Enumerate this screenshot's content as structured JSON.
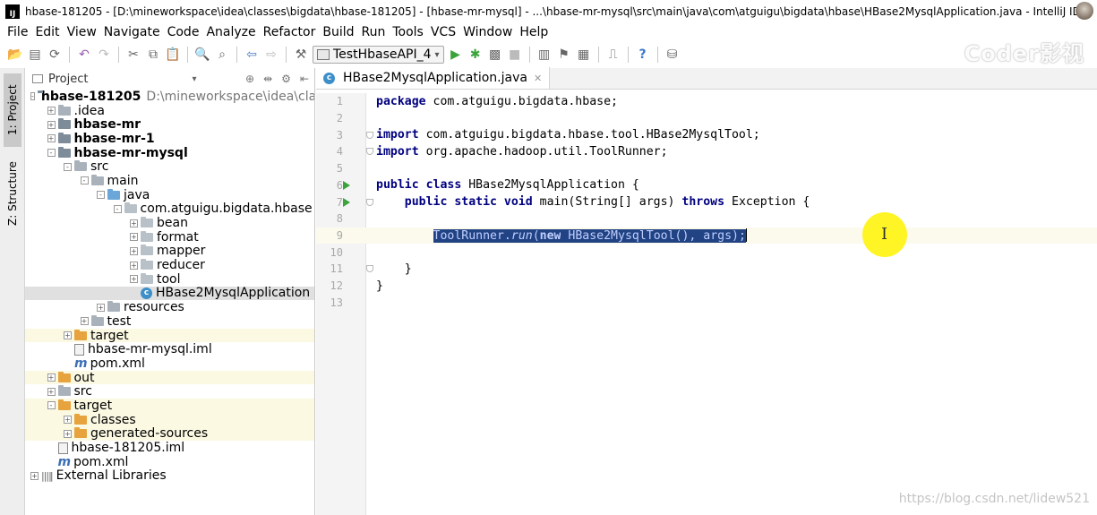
{
  "window": {
    "logo_text": "IJ",
    "title": "hbase-181205 - [D:\\mineworkspace\\idea\\classes\\bigdata\\hbase-181205] - [hbase-mr-mysql] - ...\\hbase-mr-mysql\\src\\main\\java\\com\\atguigu\\bigdata\\hbase\\HBase2MysqlApplication.java - IntelliJ IDEA 20..."
  },
  "menu": [
    "File",
    "Edit",
    "View",
    "Navigate",
    "Code",
    "Analyze",
    "Refactor",
    "Build",
    "Run",
    "Tools",
    "VCS",
    "Window",
    "Help"
  ],
  "toolbar": {
    "run_config": "TestHbaseAPI_4",
    "icons": [
      "open-icon",
      "save-icon",
      "sync-icon",
      "undo-icon",
      "redo-icon",
      "cut-icon",
      "copy-icon",
      "paste-icon",
      "find-icon",
      "replace-icon",
      "back-icon",
      "forward-icon",
      "build-icon",
      "run-icon",
      "debug-icon",
      "coverage-icon",
      "stop-icon",
      "project-structure-icon",
      "sdk-icon",
      "help-icon",
      "vcs-icon"
    ],
    "watermark": "Coder影视"
  },
  "left_strip": {
    "project_label": "1: Project",
    "structure_label": "Z: Structure"
  },
  "project_panel": {
    "header": "Project",
    "tree": [
      {
        "label": "hbase-181205",
        "extra": "D:\\mineworkspace\\idea\\cla",
        "depth": 0,
        "icon": "module",
        "bold": true,
        "exp": "-"
      },
      {
        "label": ".idea",
        "depth": 1,
        "icon": "gray",
        "exp": "+"
      },
      {
        "label": "hbase-mr",
        "depth": 1,
        "icon": "module",
        "bold": true,
        "exp": "+"
      },
      {
        "label": "hbase-mr-1",
        "depth": 1,
        "icon": "module",
        "bold": true,
        "exp": "+"
      },
      {
        "label": "hbase-mr-mysql",
        "depth": 1,
        "icon": "module",
        "bold": true,
        "exp": "-"
      },
      {
        "label": "src",
        "depth": 2,
        "icon": "gray",
        "exp": "-"
      },
      {
        "label": "main",
        "depth": 3,
        "icon": "gray",
        "exp": "-"
      },
      {
        "label": "java",
        "depth": 4,
        "icon": "blue",
        "exp": "-"
      },
      {
        "label": "com.atguigu.bigdata.hbase",
        "depth": 5,
        "icon": "pkg",
        "exp": "-"
      },
      {
        "label": "bean",
        "depth": 6,
        "icon": "pkg",
        "exp": "+"
      },
      {
        "label": "format",
        "depth": 6,
        "icon": "pkg",
        "exp": "+"
      },
      {
        "label": "mapper",
        "depth": 6,
        "icon": "pkg",
        "exp": "+"
      },
      {
        "label": "reducer",
        "depth": 6,
        "icon": "pkg",
        "exp": "+"
      },
      {
        "label": "tool",
        "depth": 6,
        "icon": "pkg",
        "exp": "+"
      },
      {
        "label": "HBase2MysqlApplication",
        "depth": 6,
        "icon": "class",
        "exp": "",
        "selected": true
      },
      {
        "label": "resources",
        "depth": 4,
        "icon": "gray",
        "exp": "+"
      },
      {
        "label": "test",
        "depth": 3,
        "icon": "gray",
        "exp": "+"
      },
      {
        "label": "target",
        "depth": 2,
        "icon": "orange",
        "exp": "+",
        "yellow": true
      },
      {
        "label": "hbase-mr-mysql.iml",
        "depth": 2,
        "icon": "file",
        "exp": ""
      },
      {
        "label": "pom.xml",
        "depth": 2,
        "icon": "m",
        "exp": ""
      },
      {
        "label": "out",
        "depth": 1,
        "icon": "orange",
        "exp": "+",
        "yellow": true
      },
      {
        "label": "src",
        "depth": 1,
        "icon": "gray",
        "exp": "+"
      },
      {
        "label": "target",
        "depth": 1,
        "icon": "orange",
        "exp": "-",
        "yellow": true
      },
      {
        "label": "classes",
        "depth": 2,
        "icon": "orange",
        "exp": "+",
        "yellow": true
      },
      {
        "label": "generated-sources",
        "depth": 2,
        "icon": "orange",
        "exp": "+",
        "yellow": true
      },
      {
        "label": "hbase-181205.iml",
        "depth": 1,
        "icon": "file",
        "exp": ""
      },
      {
        "label": "pom.xml",
        "depth": 1,
        "icon": "m",
        "exp": ""
      },
      {
        "label": "External Libraries",
        "depth": 0,
        "icon": "lib",
        "exp": "+"
      }
    ]
  },
  "editor": {
    "tab_label": "HBase2MysqlApplication.java",
    "lines": [
      {
        "n": "1",
        "tokens": [
          [
            "kw",
            "package"
          ],
          [
            "t",
            " com.atguigu.bigdata.hbase;"
          ]
        ]
      },
      {
        "n": "2",
        "tokens": []
      },
      {
        "n": "3",
        "fold": true,
        "tokens": [
          [
            "kw",
            "import"
          ],
          [
            "t",
            " com.atguigu.bigdata.hbase.tool.HBase2MysqlTool;"
          ]
        ]
      },
      {
        "n": "4",
        "fold": true,
        "tokens": [
          [
            "kw",
            "import"
          ],
          [
            "t",
            " org.apache.hadoop.util.ToolRunner;"
          ]
        ]
      },
      {
        "n": "5",
        "tokens": []
      },
      {
        "n": "6",
        "run": true,
        "tokens": [
          [
            "kw",
            "public class"
          ],
          [
            "t",
            " HBase2MysqlApplication {"
          ]
        ]
      },
      {
        "n": "7",
        "run": true,
        "fold": true,
        "tokens": [
          [
            "t",
            "    "
          ],
          [
            "kw",
            "public static void"
          ],
          [
            "t",
            " main(String[] args) "
          ],
          [
            "kw",
            "throws"
          ],
          [
            "t",
            " Exception {"
          ]
        ]
      },
      {
        "n": "8",
        "tokens": []
      },
      {
        "n": "9",
        "current": true,
        "tokens": [
          [
            "t",
            "        "
          ],
          [
            "sel",
            "ToolRunner."
          ],
          [
            "selit",
            "run"
          ],
          [
            "sel",
            "("
          ],
          [
            "selkw",
            "new"
          ],
          [
            "sel",
            " HBase2MysqlTool(), args);"
          ],
          [
            "caret",
            ""
          ]
        ]
      },
      {
        "n": "10",
        "tokens": []
      },
      {
        "n": "11",
        "fold": true,
        "tokens": [
          [
            "t",
            "    }"
          ]
        ]
      },
      {
        "n": "12",
        "tokens": [
          [
            "t",
            "}"
          ]
        ]
      },
      {
        "n": "13",
        "tokens": []
      }
    ]
  },
  "footer_watermark": "https://blog.csdn.net/lidew521"
}
